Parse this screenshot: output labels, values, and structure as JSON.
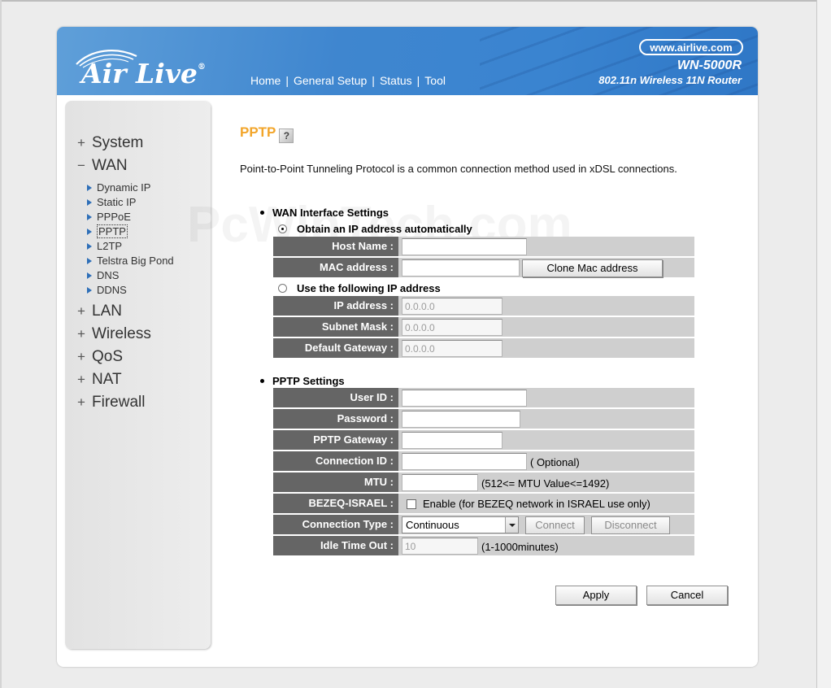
{
  "header": {
    "logo_text": "Air Live",
    "logo_reg": "®",
    "url": "www.airlive.com",
    "model_name": "WN-5000R",
    "model_desc": "802.11n Wireless 11N Router",
    "nav": [
      "Home",
      "General Setup",
      "Status",
      "Tool"
    ],
    "nav_separator": "|",
    "colors": {
      "banner": "#3f86cf",
      "title_accent": "#f2a52a",
      "label_bg": "#656565",
      "row_bg": "#cfcfcf"
    }
  },
  "sidebar": {
    "expand_symbol": "+",
    "collapse_symbol": "−",
    "items": [
      {
        "label": "System",
        "expanded": false
      },
      {
        "label": "WAN",
        "expanded": true
      },
      {
        "label": "LAN",
        "expanded": false
      },
      {
        "label": "Wireless",
        "expanded": false
      },
      {
        "label": "QoS",
        "expanded": false
      },
      {
        "label": "NAT",
        "expanded": false
      },
      {
        "label": "Firewall",
        "expanded": false
      }
    ],
    "wan_subitems": [
      "Dynamic IP",
      "Static IP",
      "PPPoE",
      "PPTP",
      "L2TP",
      "Telstra Big Pond",
      "DNS",
      "DDNS"
    ],
    "active_subitem": "PPTP"
  },
  "page": {
    "title": "PPTP",
    "help_glyph": "?",
    "description": "Point-to-Point Tunneling Protocol is a common connection method used in xDSL connections.",
    "watermark": "PcWinTech.com"
  },
  "wan_settings": {
    "heading": "WAN Interface Settings",
    "obtain_auto_label": "Obtain an IP address automatically",
    "obtain_auto_selected": true,
    "host_name": {
      "label": "Host Name :",
      "value": ""
    },
    "mac_address": {
      "label": "MAC address :",
      "value": "",
      "button": "Clone Mac address"
    },
    "use_following_label": "Use the following IP address",
    "ip_address": {
      "label": "IP address :",
      "value": "0.0.0.0"
    },
    "subnet_mask": {
      "label": "Subnet Mask :",
      "value": "0.0.0.0"
    },
    "default_gateway": {
      "label": "Default Gateway :",
      "value": "0.0.0.0"
    }
  },
  "pptp_settings": {
    "heading": "PPTP Settings",
    "user_id": {
      "label": "User ID :",
      "value": ""
    },
    "password": {
      "label": "Password :",
      "value": ""
    },
    "pptp_gateway": {
      "label": "PPTP Gateway :",
      "value": ""
    },
    "connection_id": {
      "label": "Connection ID :",
      "value": "",
      "note": "( Optional)"
    },
    "mtu": {
      "label": "MTU :",
      "value": "",
      "note": "(512<= MTU Value<=1492)"
    },
    "bezeq": {
      "label": "BEZEQ-ISRAEL :",
      "checkbox_label": "Enable (for BEZEQ network in ISRAEL use only)",
      "checked": false
    },
    "connection_type": {
      "label": "Connection Type :",
      "selected": "Continuous",
      "connect": "Connect",
      "disconnect": "Disconnect"
    },
    "idle_timeout": {
      "label": "Idle Time Out :",
      "value": "10",
      "note": "(1-1000minutes)"
    }
  },
  "actions": {
    "apply": "Apply",
    "cancel": "Cancel"
  }
}
